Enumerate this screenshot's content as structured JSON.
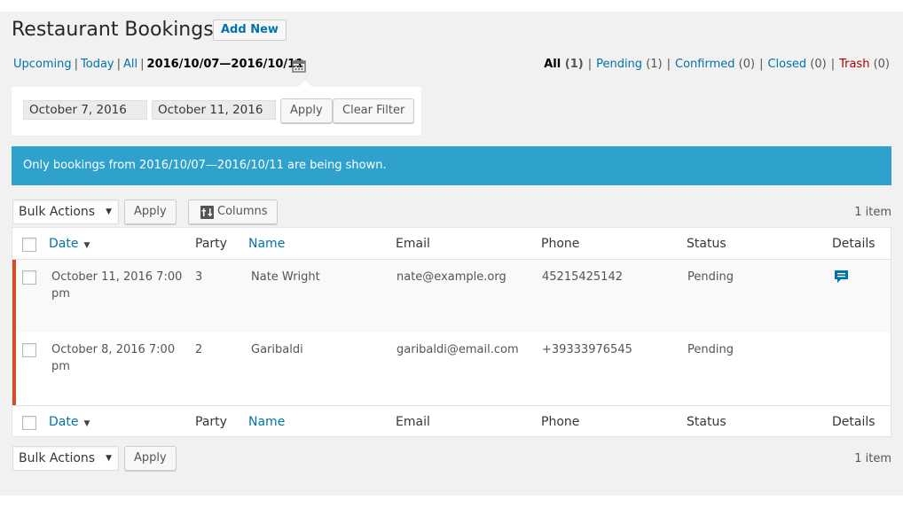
{
  "header": {
    "title": "Restaurant Bookings",
    "add_new_label": "Add New"
  },
  "date_views": {
    "upcoming": "Upcoming",
    "today": "Today",
    "all": "All",
    "current_range": "2016/10/07—2016/10/11",
    "separator": "|"
  },
  "status_views": {
    "all": {
      "label": "All",
      "count": "(1)"
    },
    "pending": {
      "label": "Pending",
      "count": "(1)"
    },
    "confirmed": {
      "label": "Confirmed",
      "count": "(0)"
    },
    "closed": {
      "label": "Closed",
      "count": "(0)"
    },
    "trash": {
      "label": "Trash",
      "count": "(0)"
    },
    "separator": "|"
  },
  "date_filter": {
    "start_value": "October 7, 2016",
    "end_value": "October 11, 2016",
    "apply_label": "Apply",
    "clear_label": "Clear Filter"
  },
  "notice": {
    "text": "Only bookings from 2016/10/07—2016/10/11 are being shown."
  },
  "top_nav": {
    "bulk_actions": "Bulk Actions",
    "apply_label": "Apply",
    "columns_label": "Columns",
    "item_count": "1 item"
  },
  "bottom_nav": {
    "bulk_actions": "Bulk Actions",
    "apply_label": "Apply",
    "item_count": "1 item"
  },
  "table": {
    "columns": {
      "date": "Date",
      "party": "Party",
      "name": "Name",
      "email": "Email",
      "phone": "Phone",
      "status": "Status",
      "details": "Details"
    },
    "rows": [
      {
        "date_line1": "October 11, 2016 7:00",
        "date_line2": "pm",
        "party": "3",
        "name": "Nate Wright",
        "email": "nate@example.org",
        "phone": "45215425142",
        "status": "Pending",
        "details_icon": "comment-icon"
      },
      {
        "date_line1": "October 8, 2016 7:00",
        "date_line2": "pm",
        "party": "2",
        "name": "Garibaldi",
        "email": "garibaldi@email.com",
        "phone": "+39333976545",
        "status": "Pending"
      }
    ]
  },
  "colors": {
    "link": "#0073aa",
    "notice": "#2ea2cc",
    "pending_border": "#d54e21",
    "trash": "#a00"
  }
}
